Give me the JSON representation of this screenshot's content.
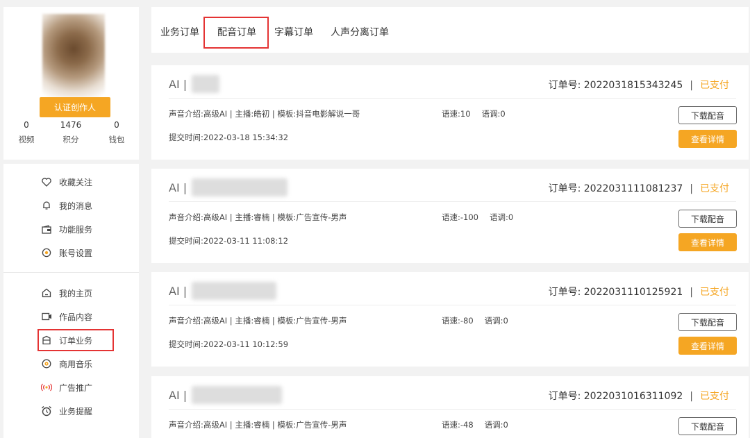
{
  "profile": {
    "certify_label": "认证创作人",
    "stats": [
      {
        "value": "0",
        "label": "视频"
      },
      {
        "value": "1476",
        "label": "积分"
      },
      {
        "value": "0",
        "label": "钱包"
      }
    ]
  },
  "menu": {
    "group1": [
      {
        "label": "收藏关注",
        "icon": "heart-icon"
      },
      {
        "label": "我的消息",
        "icon": "bell-icon"
      },
      {
        "label": "功能服务",
        "icon": "wallet-icon"
      },
      {
        "label": "账号设置",
        "icon": "settings-icon"
      }
    ],
    "group2": [
      {
        "label": "我的主页",
        "icon": "home-icon"
      },
      {
        "label": "作品内容",
        "icon": "video-icon"
      },
      {
        "label": "订单业务",
        "icon": "order-icon"
      },
      {
        "label": "商用音乐",
        "icon": "music-icon"
      },
      {
        "label": "广告推广",
        "icon": "broadcast-icon"
      },
      {
        "label": "业务提醒",
        "icon": "alarm-icon"
      }
    ]
  },
  "tabs": [
    "业务订单",
    "配音订单",
    "字幕订单",
    "人声分离订单"
  ],
  "colors": {
    "accent": "#f5a623",
    "highlight": "#e43333"
  },
  "orders": [
    {
      "title_prefix": "AI",
      "title_sep": "|",
      "order_label": "订单号:",
      "order_no": "2022031815343245",
      "sep": "|",
      "status": "已支付",
      "desc": "声音介绍:高级AI | 主播:皓初 | 模板:抖音电影解说一哥",
      "speed": "语速:10",
      "pitch": "语调:0",
      "time": "提交时间:2022-03-18 15:34:32",
      "download_label": "下载配音",
      "detail_label": "查看详情"
    },
    {
      "title_prefix": "AI",
      "title_sep": "|",
      "order_label": "订单号:",
      "order_no": "2022031111081237",
      "sep": "|",
      "status": "已支付",
      "desc": "声音介绍:高级AI | 主播:睿楠 | 模板:广告宣传-男声",
      "speed": "语速:-100",
      "pitch": "语调:0",
      "time": "提交时间:2022-03-11 11:08:12",
      "download_label": "下载配音",
      "detail_label": "查看详情"
    },
    {
      "title_prefix": "AI",
      "title_sep": "|",
      "order_label": "订单号:",
      "order_no": "2022031110125921",
      "sep": "|",
      "status": "已支付",
      "desc": "声音介绍:高级AI | 主播:睿楠 | 模板:广告宣传-男声",
      "speed": "语速:-80",
      "pitch": "语调:0",
      "time": "提交时间:2022-03-11 10:12:59",
      "download_label": "下载配音",
      "detail_label": "查看详情"
    },
    {
      "title_prefix": "AI",
      "title_sep": "|",
      "order_label": "订单号:",
      "order_no": "2022031016311092",
      "sep": "|",
      "status": "已支付",
      "desc": "声音介绍:高级AI | 主播:睿楠 | 模板:广告宣传-男声",
      "speed": "语速:-48",
      "pitch": "语调:0",
      "download_label": "下载配音"
    }
  ]
}
